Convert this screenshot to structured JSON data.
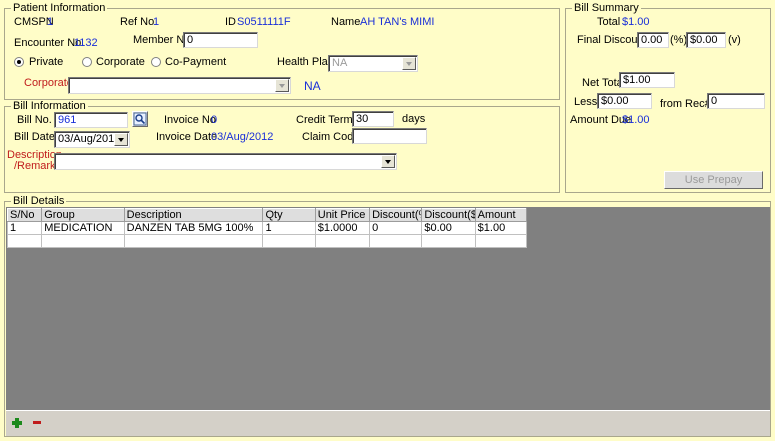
{
  "patient": {
    "legend": "Patient Information",
    "cmspn_label": "CMSPN",
    "cmspn_value": "1",
    "refno_label": "Ref No",
    "refno_value": "1",
    "id_label": "ID",
    "id_value": "S0511111F",
    "name_label": "Name",
    "name_value": "AH TAN's MIMI",
    "encounter_label": "Encounter No.",
    "encounter_value": "1132",
    "member_label": "Member No.",
    "member_value": "0",
    "payment_options": [
      "Private",
      "Corporate",
      "Co-Payment"
    ],
    "payment_selected": "Private",
    "health_plan_label": "Health Plan",
    "health_plan_value": "NA",
    "corporate_label": "Corporate",
    "corporate_value": "",
    "corporate_na": "NA"
  },
  "bill_info": {
    "legend": "Bill Information",
    "billno_label": "Bill No.",
    "billno_value": "961",
    "invoice_label": "Invoice No",
    "invoice_value": "0",
    "credit_terms_label": "Credit Terms",
    "credit_terms_value": "30",
    "credit_terms_unit": "days",
    "bill_date_label": "Bill Date",
    "bill_date_value": "03/Aug/2012",
    "invoice_date_label": "Invoice Date",
    "invoice_date_value": "03/Aug/2012",
    "claim_code_label": "Claim Code",
    "claim_code_value": "",
    "description_label_1": "Description",
    "description_label_2": "/Remarks",
    "description_value": ""
  },
  "summary": {
    "legend": "Bill Summary",
    "total_label": "Total",
    "total_value": "$1.00",
    "final_discount_label": "Final Discount",
    "final_discount_pct": "0.00",
    "pct_unit": "(%)",
    "final_discount_amt": "$0.00",
    "amt_unit": "(v)",
    "net_total_label": "Net Total",
    "net_total_value": "$1.00",
    "less_label": "Less",
    "less_value": "$0.00",
    "from_rec_label": "from Rec#",
    "from_rec_value": "0",
    "amount_due_label": "Amount Due",
    "amount_due_value": "$1.00",
    "use_prepay_label": "Use Prepay"
  },
  "details": {
    "legend": "Bill Details",
    "columns": [
      "S/No",
      "Group",
      "Description",
      "Qty",
      "Unit Price",
      "Discount(%)",
      "Discount($)",
      "Amount"
    ],
    "rows": [
      [
        "1",
        "MEDICATION",
        "DANZEN TAB 5MG 100%",
        "1",
        "$1.0000",
        "0",
        "$0.00",
        "$1.00"
      ],
      [
        "",
        "",
        "",
        "",
        "",
        "",
        "",
        ""
      ]
    ],
    "add_icon": "plus-icon",
    "remove_icon": "minus-icon"
  },
  "colors": {
    "background": "#fffdc8",
    "value_blue": "#1a2fd8",
    "label_red": "#c01c1c",
    "grid_bg": "#808080",
    "add_green": "#1d8a1d",
    "remove_red": "#c01c1c"
  }
}
